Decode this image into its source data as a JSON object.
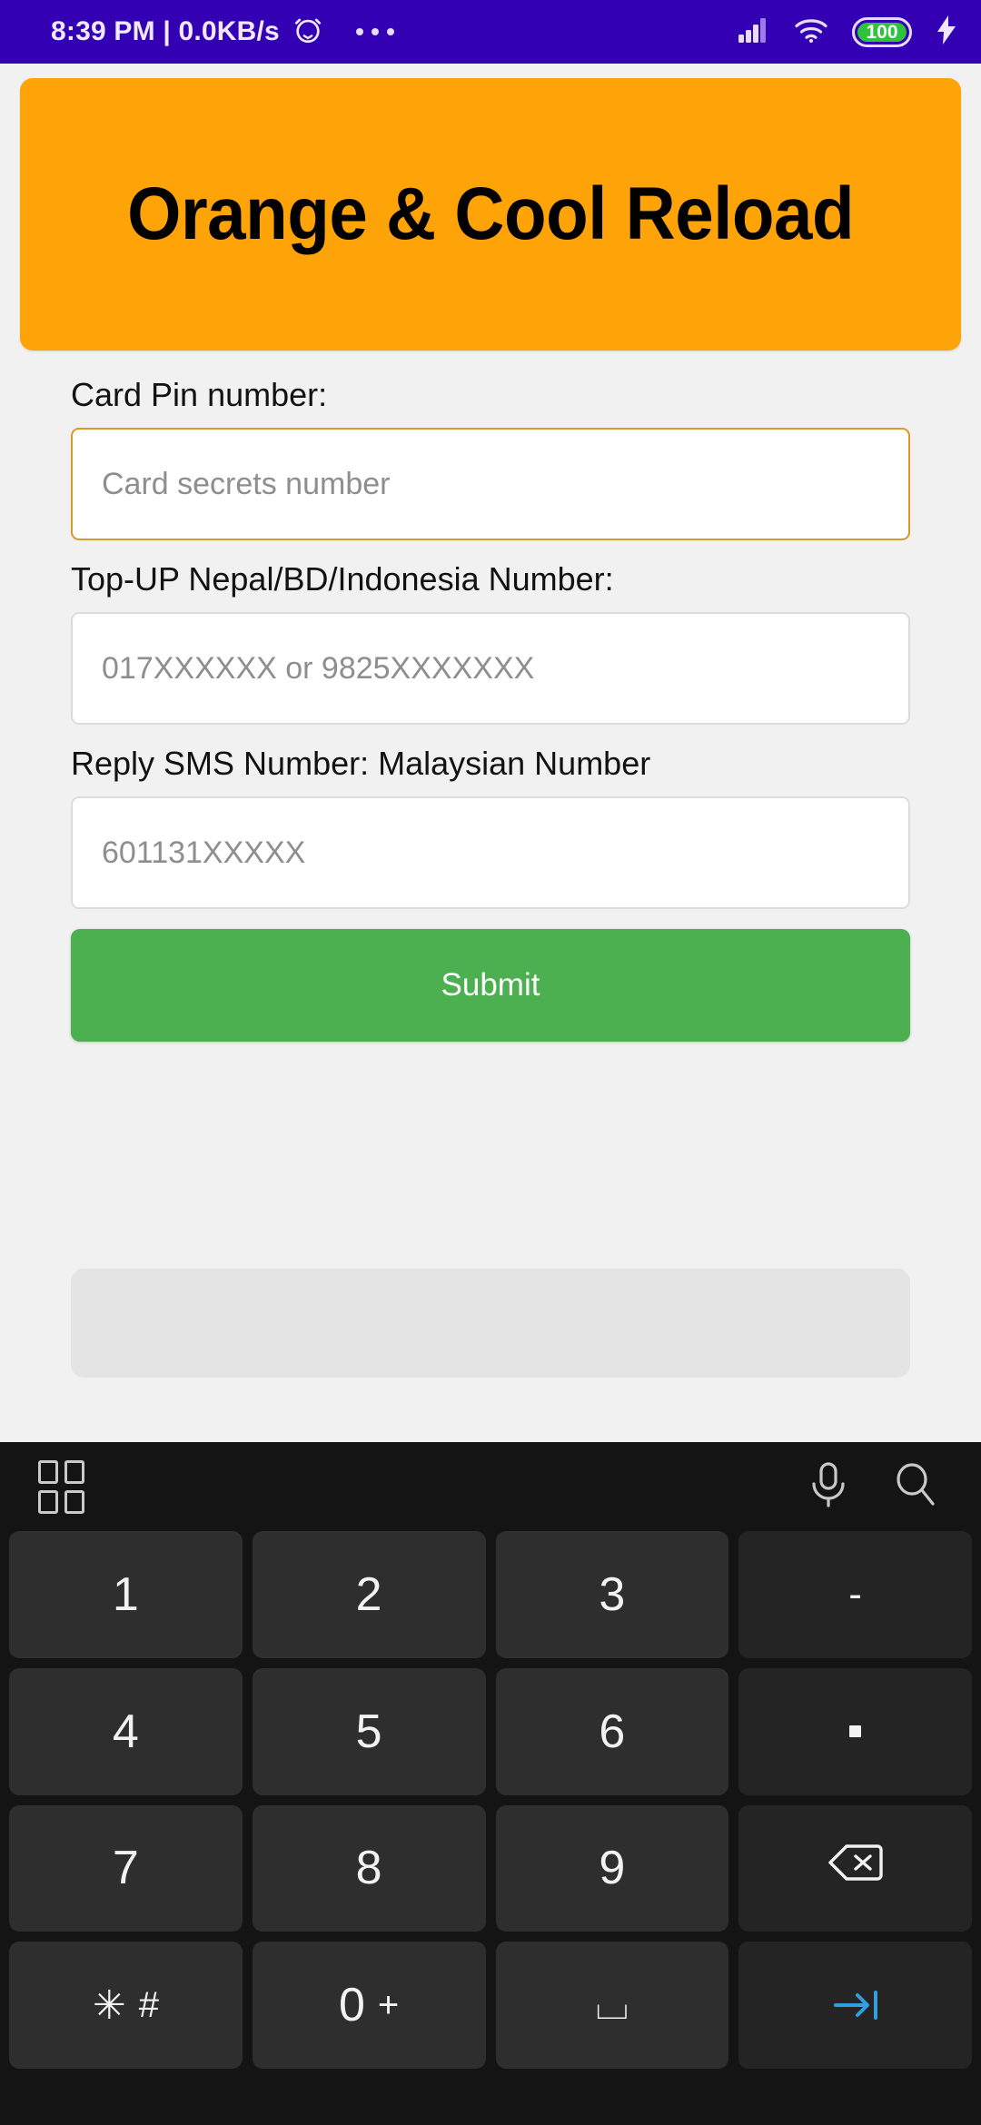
{
  "statusbar": {
    "clock": "8:39 PM | 0.0KB/s",
    "alarm_icon": "alarm-clock-icon",
    "overflow_icon": "more-dots-icon",
    "signal_icon": "cellular-signal-icon",
    "wifi_icon": "wifi-icon",
    "battery_level": "100",
    "charging_icon": "charging-bolt-icon",
    "bg_color": "#3300B3",
    "battery_color": "#2fc23b"
  },
  "header": {
    "title": "Orange & Cool Reload",
    "bg_color": "#FFA408",
    "text_color": "#000000"
  },
  "form": {
    "fields": [
      {
        "label": "Card Pin number:",
        "placeholder": "Card secrets number",
        "value": "",
        "focused": true
      },
      {
        "label": "Top-UP Nepal/BD/Indonesia Number:",
        "placeholder": "017XXXXXX or 9825XXXXXXX",
        "value": "",
        "focused": false
      },
      {
        "label": "Reply SMS Number: Malaysian Number",
        "placeholder": "601131XXXXX",
        "value": "",
        "focused": false
      }
    ],
    "submit_label": "Submit",
    "submit_color": "#4CAF50",
    "focus_border_color": "#d79a2b"
  },
  "keyboard": {
    "toolbar": {
      "grid_icon": "grid-menu-icon",
      "mic_icon": "microphone-icon",
      "search_icon": "search-icon"
    },
    "rows": [
      [
        {
          "label": "1",
          "name": "key-1",
          "type": "digit"
        },
        {
          "label": "2",
          "name": "key-2",
          "type": "digit"
        },
        {
          "label": "3",
          "name": "key-3",
          "type": "digit"
        },
        {
          "label": "-",
          "name": "key-dash",
          "type": "fn"
        }
      ],
      [
        {
          "label": "4",
          "name": "key-4",
          "type": "digit"
        },
        {
          "label": "5",
          "name": "key-5",
          "type": "digit"
        },
        {
          "label": "6",
          "name": "key-6",
          "type": "digit"
        },
        {
          "label": ".",
          "name": "key-period",
          "type": "dot"
        }
      ],
      [
        {
          "label": "7",
          "name": "key-7",
          "type": "digit"
        },
        {
          "label": "8",
          "name": "key-8",
          "type": "digit"
        },
        {
          "label": "9",
          "name": "key-9",
          "type": "digit"
        },
        {
          "label": "",
          "name": "key-backspace",
          "type": "backspace"
        }
      ],
      [
        {
          "label": "✳",
          "sub": "#",
          "name": "key-star-hash",
          "type": "fn"
        },
        {
          "label": "0",
          "sub": "+",
          "name": "key-0-plus",
          "type": "digit"
        },
        {
          "label": "⌴",
          "name": "key-space",
          "type": "space"
        },
        {
          "label": "",
          "name": "key-tab-next",
          "type": "tab"
        }
      ]
    ],
    "bg_color": "#141414",
    "key_color": "#2e2e2e",
    "accent_color": "#2f9fe0"
  }
}
